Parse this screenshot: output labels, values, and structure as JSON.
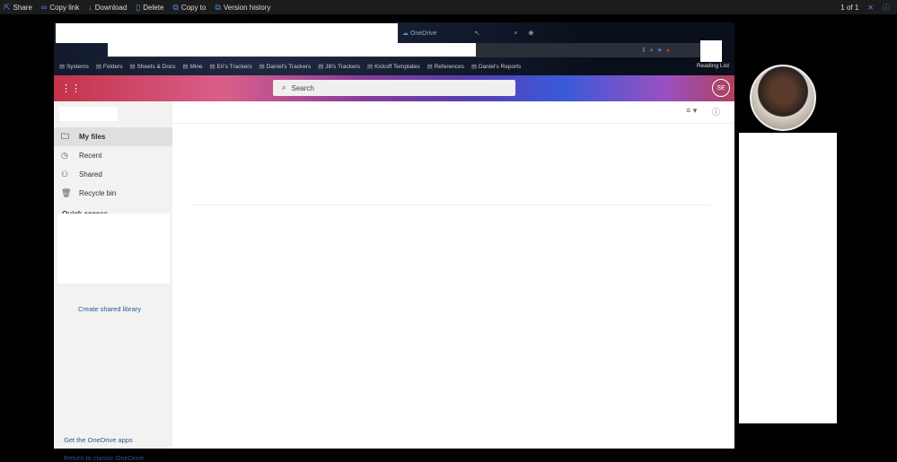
{
  "toolbar": {
    "share": "Share",
    "copy_link": "Copy link",
    "download": "Download",
    "delete": "Delete",
    "copy_to": "Copy to",
    "version_history": "Version history",
    "pager": "1 of 1"
  },
  "browser": {
    "tab_title": "OneDrive",
    "bookmarks": [
      "Systems",
      "Folders",
      "Sheets & Docs",
      "Mine",
      "Eri's Trackers",
      "Daniel's Trackers",
      "Jill's Trackers",
      "Kickoff Templates",
      "References",
      "Daniel's Reports"
    ],
    "reading_list": "Reading List"
  },
  "onedrive": {
    "search_placeholder": "Search",
    "user_initials": "SE",
    "nav": [
      {
        "label": "My files",
        "icon": "folder-icon",
        "glyph": "🗀"
      },
      {
        "label": "Recent",
        "icon": "clock-icon",
        "glyph": "◷"
      },
      {
        "label": "Shared",
        "icon": "people-icon",
        "glyph": "⚇"
      },
      {
        "label": "Recycle bin",
        "icon": "trash-icon",
        "glyph": "🗑"
      }
    ],
    "quick_access": "Quick access",
    "create_shared_library": "Create shared library",
    "get_apps": "Get the OneDrive apps",
    "return_classic": "Return to classic OneDrive"
  }
}
